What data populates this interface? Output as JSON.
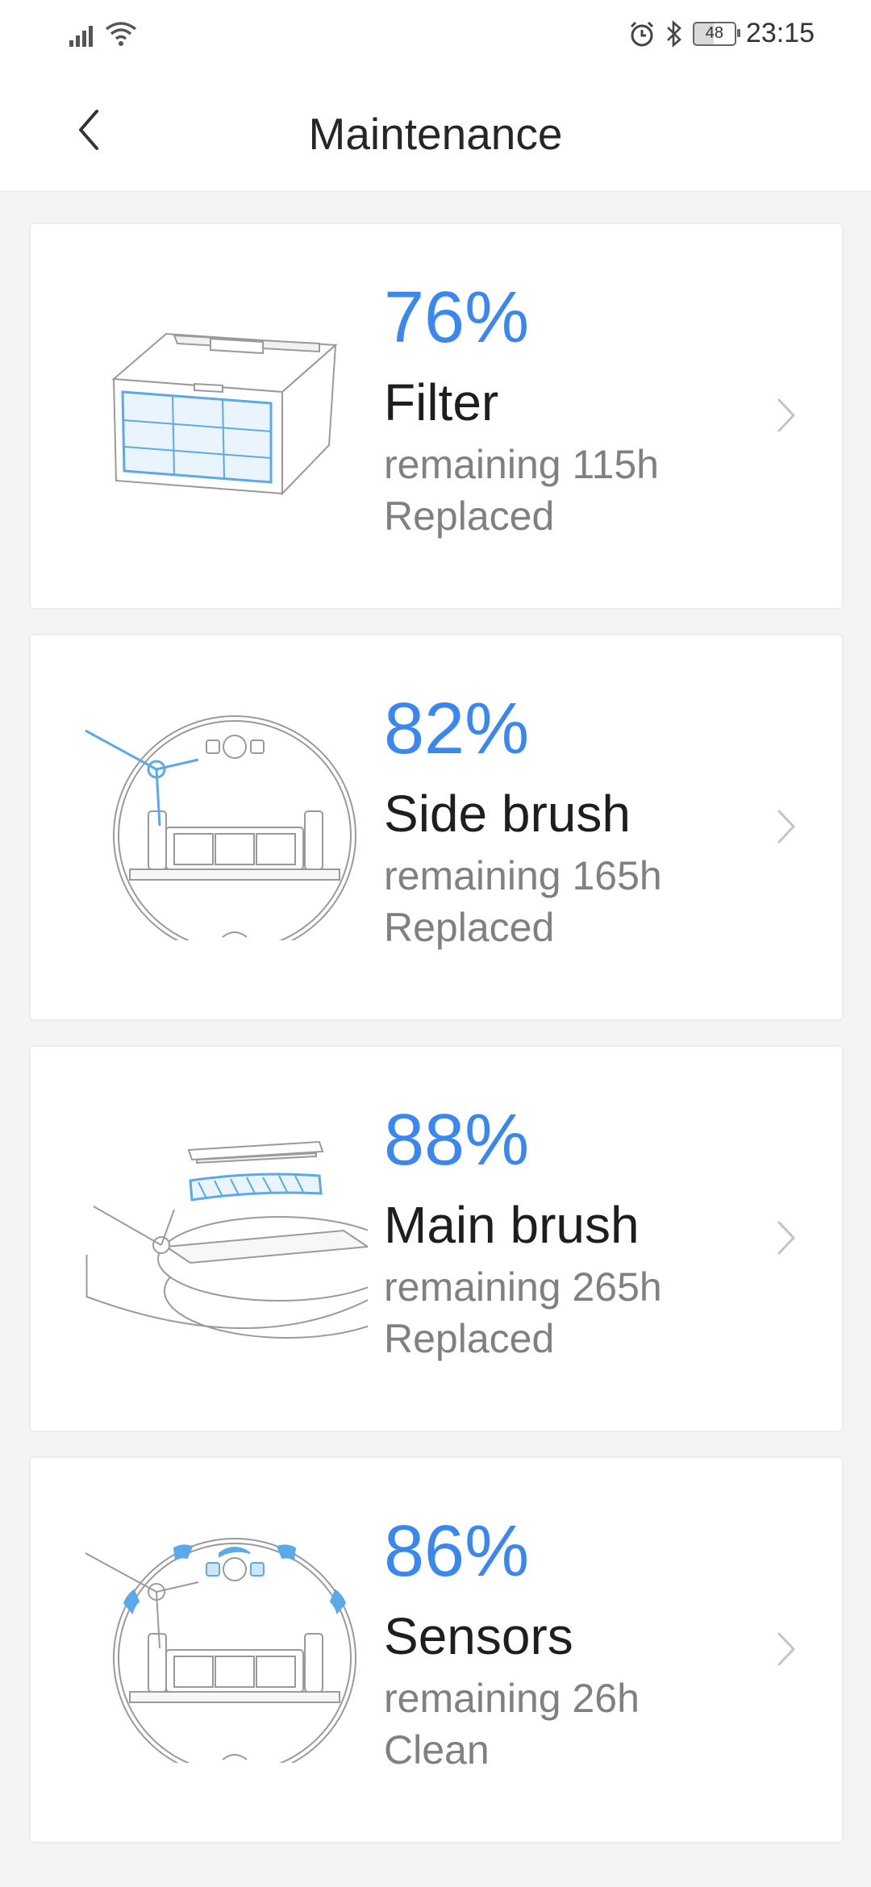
{
  "status_bar": {
    "time": "23:15",
    "battery": "48",
    "icons": [
      "signal-icon",
      "wifi-icon",
      "alarm-icon",
      "bluetooth-icon",
      "battery-icon"
    ]
  },
  "header": {
    "title": "Maintenance",
    "back_icon": "back-chevron-icon"
  },
  "colors": {
    "accent": "#3a87f0",
    "illustration_line": "#9a9a9a",
    "illustration_highlight": "#5aa9ea",
    "secondary_text": "#808080"
  },
  "items": [
    {
      "percent": "76%",
      "name": "Filter",
      "remaining": "remaining 115h",
      "status": "Replaced",
      "icon": "filter-icon"
    },
    {
      "percent": "82%",
      "name": "Side brush",
      "remaining": "remaining 165h",
      "status": "Replaced",
      "icon": "side-brush-icon"
    },
    {
      "percent": "88%",
      "name": "Main brush",
      "remaining": "remaining 265h",
      "status": "Replaced",
      "icon": "main-brush-icon"
    },
    {
      "percent": "86%",
      "name": "Sensors",
      "remaining": "remaining 26h",
      "status": "Clean",
      "icon": "sensors-icon"
    }
  ]
}
